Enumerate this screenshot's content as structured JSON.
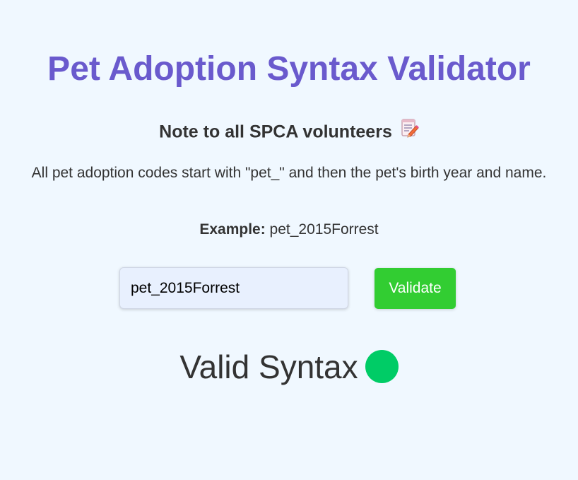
{
  "header": {
    "title": "Pet Adoption Syntax Validator"
  },
  "note": {
    "heading": "Note to all SPCA volunteers",
    "icon": "memo-icon"
  },
  "description": "All pet adoption codes start with \"pet_\" and then the pet's birth year and name.",
  "example": {
    "label": "Example:",
    "value": "pet_2015Forrest"
  },
  "form": {
    "input_value": "pet_2015Forrest",
    "button_label": "Validate"
  },
  "result": {
    "text": "Valid Syntax",
    "status_color": "#00cc66"
  },
  "colors": {
    "title": "#6a5acd",
    "button": "#32cd32",
    "background": "#f0f8ff"
  }
}
